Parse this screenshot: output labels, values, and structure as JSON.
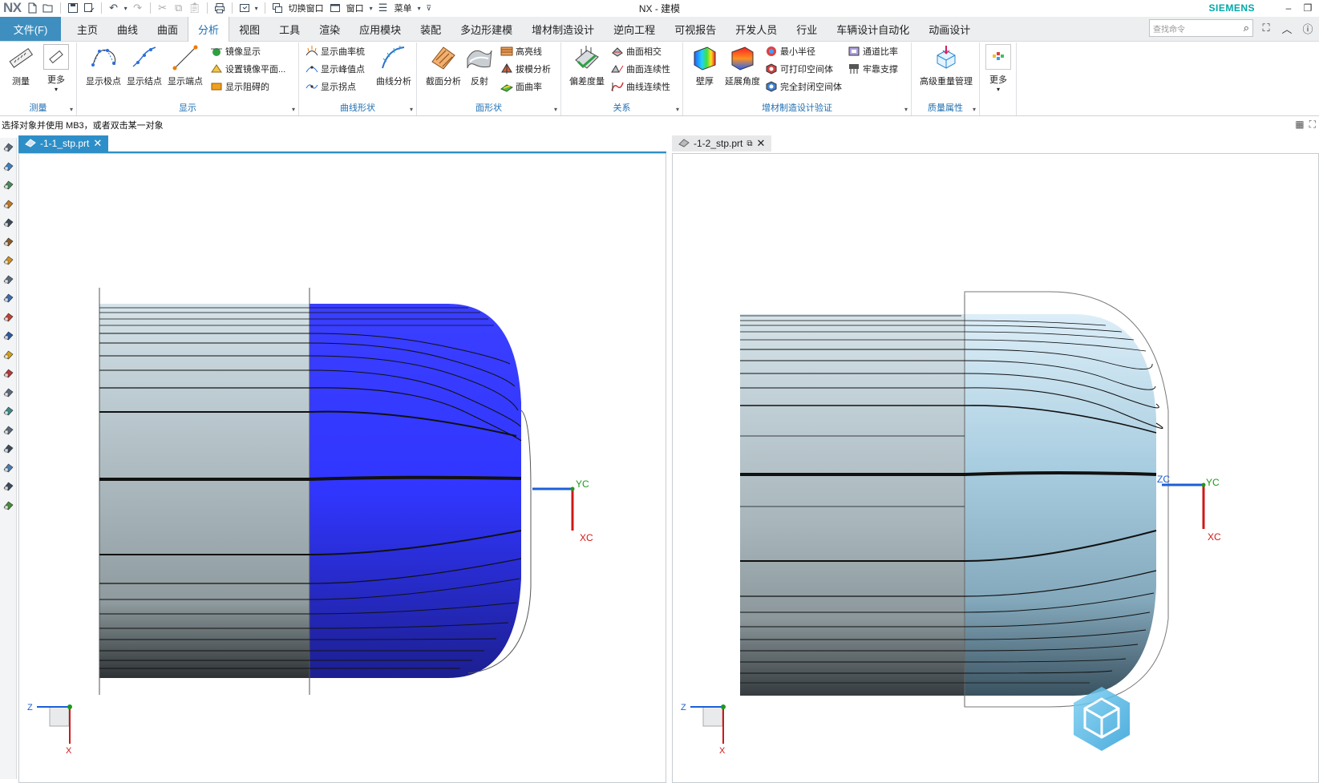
{
  "titlebar": {
    "logo": "NX",
    "title": "NX - 建模",
    "brand": "SIEMENS",
    "switch_window": "切换窗口",
    "window_menu": "窗口",
    "menu_menu": "菜单"
  },
  "menubar": {
    "file_tab": "文件(F)",
    "tabs": [
      "主页",
      "曲线",
      "曲面",
      "分析",
      "视图",
      "工具",
      "渲染",
      "应用模块",
      "装配",
      "多边形建模",
      "增材制造设计",
      "逆向工程",
      "可视报告",
      "开发人员",
      "行业",
      "车辆设计自动化",
      "动画设计"
    ],
    "active_tab": "分析",
    "search_placeholder": "查找命令"
  },
  "ribbon": {
    "groups": {
      "measure": {
        "label": "测量",
        "measure": "测量",
        "more": "更多"
      },
      "display": {
        "label": "显示",
        "show_poles": "显示极点",
        "show_knots": "显示结点",
        "show_endpoints": "显示端点",
        "mirror_display": "镜像显示",
        "set_mirror_plane": "设置镜像平面...",
        "show_blocked": "显示阻碍的"
      },
      "curve_shape": {
        "label": "曲线形状",
        "show_curvature_comb": "显示曲率梳",
        "show_peak_points": "显示峰值点",
        "show_inflections": "显示拐点",
        "curve_analysis": "曲线分析"
      },
      "face_shape": {
        "label": "面形状",
        "section_analysis": "截面分析",
        "reflection": "反射",
        "highlight_lines": "高亮线",
        "draft_analysis": "拔模分析",
        "face_curvature": "面曲率"
      },
      "relation": {
        "label": "关系",
        "deviation_gauge": "偏差度量",
        "face_intersect": "曲面相交",
        "face_continuity": "曲面连续性",
        "curve_continuity": "曲线连续性"
      },
      "am_validation": {
        "label": "增材制造设计验证",
        "wall_thickness": "壁厚",
        "overhang_angle": "延展角度",
        "min_radius": "最小半径",
        "printable_void": "可打印空间体",
        "enclosed_void": "完全封闭空间体",
        "channel_ratio": "通道比率",
        "support": "牢靠支撑"
      },
      "mass": {
        "label": "质量属性",
        "advanced_mass": "高级重量管理"
      },
      "more": {
        "more": "更多"
      }
    }
  },
  "status": {
    "prompt": "选择对象并使用 MB3，或者双击某一对象"
  },
  "viewports": {
    "left": {
      "tab": "-1-1_stp.prt",
      "axis_yc": "YC",
      "axis_xc": "XC",
      "triad_z": "Z",
      "triad_x": "X"
    },
    "right": {
      "tab": "-1-2_stp.prt",
      "axis_zc": "ZC",
      "axis_yc": "YC",
      "axis_xc": "XC",
      "triad_z": "Z",
      "triad_x": "X"
    }
  },
  "colors": {
    "accent": "#2e8fc8",
    "file_tab": "#3e8fbf",
    "brand": "#00a8a8",
    "highlight_blue": "#2f36ff",
    "xc": "#d01818",
    "yc": "#1a9a1a",
    "zc": "#1c5fd8"
  }
}
